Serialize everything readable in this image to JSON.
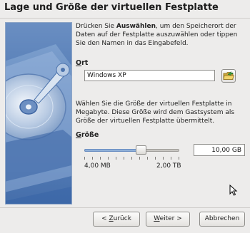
{
  "dialog": {
    "title": "Lage und Größe der virtuellen Festplatte"
  },
  "intro": {
    "part1": "Drücken Sie ",
    "bold": "Auswählen",
    "part2": ", um den Speicherort der Daten auf der Festplatte auszuwählen oder tippen Sie den Namen in das Eingabefeld."
  },
  "location": {
    "label_mnemonic": "O",
    "label_rest": "rt",
    "value": "Windows XP",
    "browse_icon": "folder-open-icon"
  },
  "size_info": "Wählen Sie die Größe der virtuellen Festplatte in Megabyte. Diese Größe wird dem Gastsystem als Größe der virtuellen Festplatte übermittelt.",
  "size": {
    "label_mnemonic": "G",
    "label_rest": "röße",
    "slider_min_label": "4,00 MB",
    "slider_max_label": "2,00 TB",
    "slider_position_fraction": 0.6,
    "value": "10,00 GB"
  },
  "buttons": {
    "back_prefix": "< ",
    "back_mnemonic": "Z",
    "back_rest": "urück",
    "next_mnemonic": "W",
    "next_rest": "eiter >",
    "cancel": "Abbrechen"
  }
}
